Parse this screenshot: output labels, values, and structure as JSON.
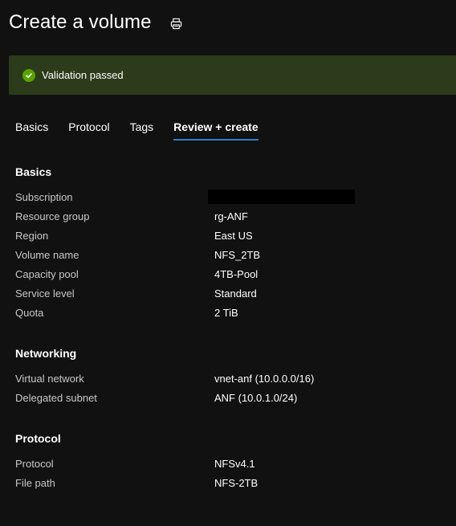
{
  "header": {
    "title": "Create a volume",
    "print_icon": "printer-icon"
  },
  "banner": {
    "icon": "check-circle-icon",
    "text": "Validation passed",
    "color": "#57a300"
  },
  "tabs": [
    {
      "label": "Basics",
      "active": false
    },
    {
      "label": "Protocol",
      "active": false
    },
    {
      "label": "Tags",
      "active": false
    },
    {
      "label": "Review + create",
      "active": true
    }
  ],
  "sections": {
    "basics": {
      "title": "Basics",
      "rows": [
        {
          "label": "Subscription",
          "value": ""
        },
        {
          "label": "Resource group",
          "value": "rg-ANF"
        },
        {
          "label": "Region",
          "value": "East US"
        },
        {
          "label": "Volume name",
          "value": "NFS_2TB"
        },
        {
          "label": "Capacity pool",
          "value": "4TB-Pool"
        },
        {
          "label": "Service level",
          "value": "Standard"
        },
        {
          "label": "Quota",
          "value": "2 TiB"
        }
      ]
    },
    "networking": {
      "title": "Networking",
      "rows": [
        {
          "label": "Virtual network",
          "value": "vnet-anf (10.0.0.0/16)"
        },
        {
          "label": "Delegated subnet",
          "value": "ANF (10.0.1.0/24)"
        }
      ]
    },
    "protocol": {
      "title": "Protocol",
      "rows": [
        {
          "label": "Protocol",
          "value": "NFSv4.1"
        },
        {
          "label": "File path",
          "value": "NFS-2TB"
        }
      ]
    }
  },
  "colors": {
    "background": "#111111",
    "banner_bg": "#2c3b1a",
    "accent": "#2f80d1",
    "success": "#57a300"
  }
}
